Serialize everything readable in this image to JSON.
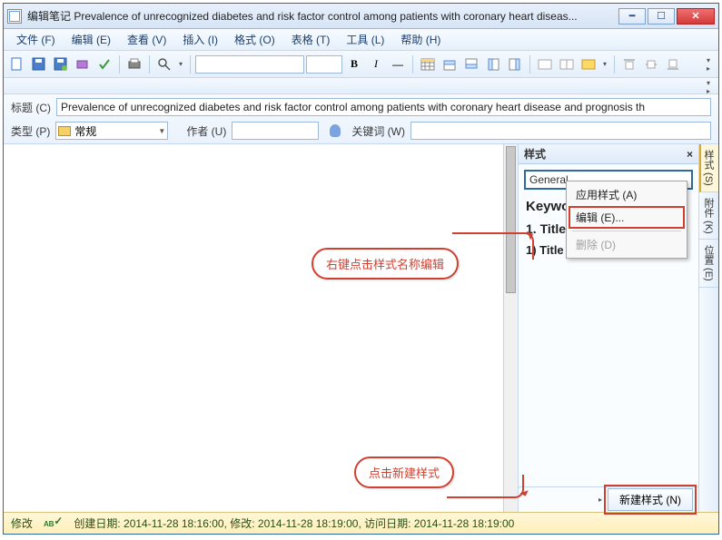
{
  "window": {
    "title": "编辑笔记 Prevalence of unrecognized diabetes and risk factor control among patients with coronary heart diseas..."
  },
  "menu": {
    "file": "文件 (F)",
    "edit": "编辑 (E)",
    "view": "查看 (V)",
    "insert": "插入 (I)",
    "format": "格式 (O)",
    "table": "表格 (T)",
    "tools": "工具 (L)",
    "help": "帮助 (H)"
  },
  "toolbar": {
    "bold": "B",
    "italic": "I",
    "hr": "―"
  },
  "fields": {
    "title_label": "标题 (C)",
    "title_value": "Prevalence of unrecognized diabetes and risk factor control among patients with coronary heart disease and prognosis th",
    "type_label": "类型 (P)",
    "type_value": "常规",
    "author_label": "作者 (U)",
    "author_value": "",
    "keywords_label": "关键词 (W)",
    "keywords_value": ""
  },
  "styles_panel": {
    "title": "样式",
    "selected": "General",
    "items": {
      "keywords": "Keywords",
      "t1": "1.  Title 1",
      "t2": "1)  Title 2"
    },
    "context": {
      "apply": "应用样式 (A)",
      "edit": "编辑 (E)...",
      "delete": "删除 (D)"
    },
    "new_btn": "新建样式 (N)"
  },
  "vert_tabs": {
    "style": "样式 (S)",
    "attach": "附件 (K)",
    "position": "位置 (E)"
  },
  "status": {
    "mode": "修改",
    "dates": "创建日期: 2014-11-28 18:16:00, 修改: 2014-11-28 18:19:00, 访问日期: 2014-11-28 18:19:00"
  },
  "callouts": {
    "c1": "右键点击样式名称编辑",
    "c2": "点击新建样式"
  }
}
